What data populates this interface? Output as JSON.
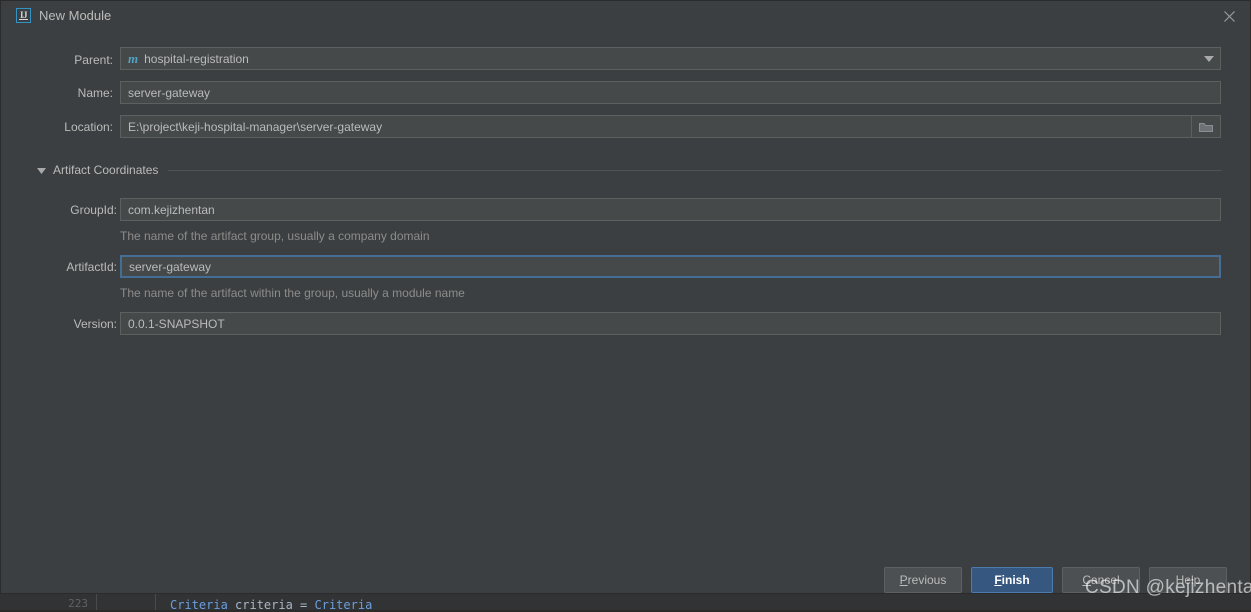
{
  "window": {
    "title": "New Module",
    "icon": "intellij-idea-icon",
    "close_icon": "close-icon"
  },
  "form": {
    "parent": {
      "label": "Parent:",
      "value": "hospital-registration",
      "icon": "maven-module-icon",
      "icon_glyph": "m",
      "dropdown_icon": "chevron-down-icon"
    },
    "name": {
      "label": "Name:",
      "value": "server-gateway",
      "placeholder": ""
    },
    "location": {
      "label": "Location:",
      "value": "E:\\project\\keji-hospital-manager\\server-gateway",
      "browse_icon": "folder-icon"
    }
  },
  "artifact_section": {
    "title": "Artifact Coordinates",
    "collapse_icon": "triangle-down-icon",
    "expanded": true,
    "fields": [
      {
        "label": "GroupId:",
        "value": "com.kejizhentan",
        "hint": "The name of the artifact group, usually a company domain",
        "focused": false
      },
      {
        "label": "ArtifactId:",
        "value": "server-gateway",
        "hint": "The name of the artifact within the group, usually a module name",
        "focused": true
      },
      {
        "label": "Version:",
        "value": "0.0.1-SNAPSHOT",
        "hint": "",
        "focused": false
      }
    ]
  },
  "buttons": {
    "previous": {
      "mnemonic": "P",
      "rest": "revious"
    },
    "finish": {
      "mnemonic": "F",
      "rest": "inish"
    },
    "cancel": {
      "mnemonic": "C",
      "rest": "ancel"
    },
    "help": {
      "mnemonic": "",
      "rest": "Help"
    }
  },
  "watermark": {
    "text": "CSDN @kejizhentan"
  },
  "background_editor": {
    "line_number": "223",
    "code_keyword": "Criteria",
    "code_var": " criteria = ",
    "code_type": "Criteria"
  },
  "colors": {
    "dialog_bg": "#3c3f41",
    "field_bg": "#45494a",
    "field_border": "#5e6060",
    "focus_border": "#466d94",
    "primary_button": "#365880",
    "text": "#bbbbbb",
    "hint_text": "#8c8c8c",
    "maven_icon": "#51a2c4",
    "editor_bg": "#2b2b2b"
  }
}
